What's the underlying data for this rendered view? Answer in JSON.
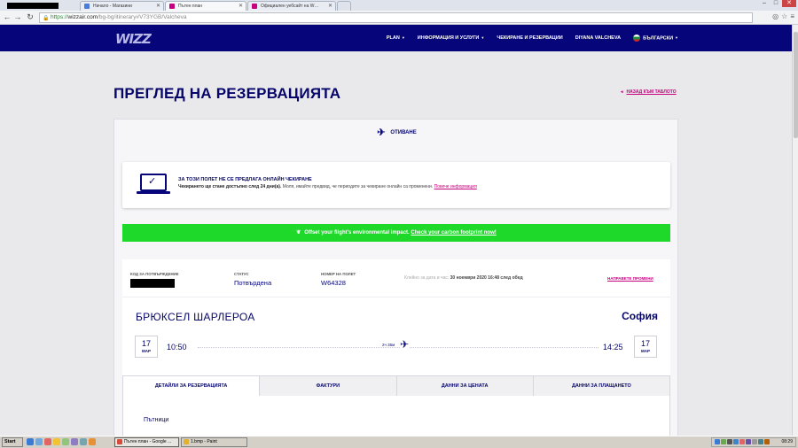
{
  "browser": {
    "tabs": [
      {
        "label": "",
        "redacted": true
      },
      {
        "label": "Начало - Магазини",
        "fav_color": "#4a7cd8"
      },
      {
        "label": "Пътен план",
        "fav_color": "#c6007e",
        "active": true
      },
      {
        "label": "Официален уебсайт на W…",
        "fav_color": "#c6007e"
      }
    ],
    "url_scheme": "https://",
    "url_host": "wizzair.com",
    "url_path": "/bg-bg/itinerary#V73YGB/Valcheva"
  },
  "header": {
    "logo": "WIZZ",
    "nav": [
      {
        "label": "PLAN",
        "caret": true
      },
      {
        "label": "ИНФОРМАЦИЯ И УСЛУГИ",
        "caret": true
      },
      {
        "label": "ЧЕКИРАНЕ И РЕЗЕРВАЦИИ",
        "caret": false
      },
      {
        "label": "DIYANA VALCHEVA",
        "caret": false
      },
      {
        "label": "БЪЛГАРСКИ",
        "caret": true,
        "flag": true
      }
    ]
  },
  "page": {
    "title": "ПРЕГЛЕД НА РЕЗЕРВАЦИЯТА",
    "back_link": "НАЗАД КЪМ ТАБЛОТО"
  },
  "departure": {
    "label": "ОТИВАНЕ",
    "icon": "plane-icon"
  },
  "notice": {
    "title": "ЗА ТОЗИ ПОЛЕТ НЕ СЕ ПРЕДЛАГА ОНЛАЙН ЧЕКИРАНЕ",
    "text_bold": "Чекирането ще стане достъпно след 24 дни(а).",
    "text": " Моля, имайте предвид, че периодите за чекиране онлайн са променени.",
    "link": "Повече информация",
    "icon": "laptop-check-icon"
  },
  "carbon": {
    "text": "Offset your flight's environmental impact.",
    "link": "Check your carbon footprint now!",
    "icon": "leaf-icon",
    "color": "#1ed82a"
  },
  "booking": {
    "code_label": "КОД ЗА ПОТВЪРЖДЕНИЕ",
    "code_redacted": true,
    "status_label": "СТАТУС",
    "status_value": "Потвърдена",
    "flight_label": "НОМЕР НА ПОЛЕТ",
    "flight_value": "W64328",
    "issued_label": "Клейно за дата и час:",
    "issued_value": "30 ноември 2020 16:48 след обед",
    "change_link": "НАПРАВЕТЕ ПРОМЕНИ"
  },
  "route": {
    "from": "БРЮКСЕЛ ШАРЛЕРОА",
    "to": "София",
    "dep_day": "17",
    "dep_month": "МАР",
    "dep_time": "10:50",
    "arr_day": "17",
    "arr_month": "МАР",
    "arr_time": "14:25",
    "duration": "2ч 35м"
  },
  "tabs": [
    {
      "label": "ДЕТАЙЛИ ЗА РЕЗЕРВАЦИЯТА",
      "active": true
    },
    {
      "label": "ФАКТУРИ",
      "active": false
    },
    {
      "label": "ДАННИ ЗА ЦЕНАТА",
      "active": false
    },
    {
      "label": "ДАННИ ЗА ПЛАЩАНЕТО",
      "active": false
    }
  ],
  "passengers_heading": "Пътници",
  "taskbar": {
    "start": "Start",
    "tasks": [
      {
        "label": "Пътен план - Google ...",
        "active": true,
        "icon_color": "#d84a3a"
      },
      {
        "label": "1.bmp - Paint",
        "active": false,
        "icon_color": "#e0b030"
      }
    ],
    "clock": "08:29"
  },
  "colors": {
    "brand_navy": "#06067a",
    "accent_pink": "#c6007e",
    "success_green": "#1ed82a"
  }
}
